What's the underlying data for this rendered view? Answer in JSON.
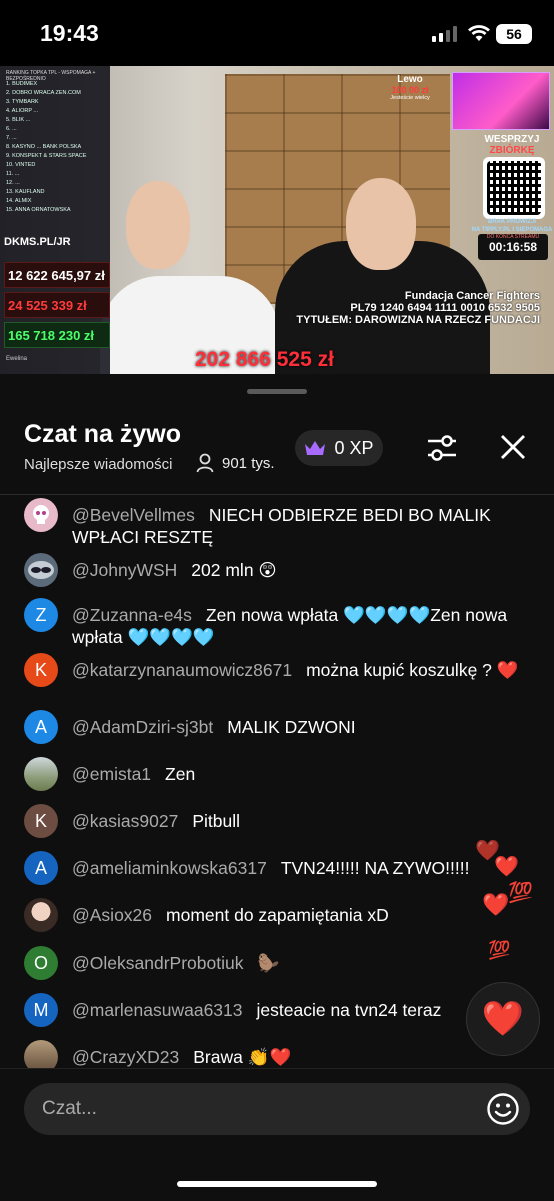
{
  "status_bar": {
    "time": "19:43",
    "battery": "56"
  },
  "stream": {
    "ranking_title": "RANKING   TOPKA TPL - WSPOMAGA + BEZPOŚREDNIO",
    "ranking": [
      "1. BUDIMEX",
      "2. DOBRO WRACA ZEN.COM",
      "3. TYMBARK",
      "4. ALIORP ...",
      "5. BLIK ...",
      "6. ...",
      "7. ...",
      "8. KASYNO ... BANK POLSKA",
      "9. KONSPEKT & STARS SPACE",
      "10. VINTED",
      "11. ...",
      "12. ...",
      "13. KAUFLAND",
      "14. ALMIX",
      "15. ANNA ORNATOWSKA"
    ],
    "dkms": "DKMS.PL/JR",
    "stat1_value": "12 622 645,97 zł",
    "stat2_value": "24 525 339 zł",
    "stat3_value": "165 718 230 zł",
    "small_line": "Ewelina",
    "lewo_title": "Lewo",
    "lewo_value": "100 00 zł",
    "lewo_sub": "Jesteście wielcy",
    "support_line1": "WESPRZYJ",
    "support_line2": "ZBIÓRKĘ",
    "brak_line1": "BRAK PROWIZJI",
    "brak_line2": "NA TIPPLY.PL I SIEPOMAGA",
    "timer_label": "DO KOŃCA STREAMU",
    "timer_value": "00:16:58",
    "fund_line1": "Fundacja Cancer Fighters",
    "fund_line2": "PL79 1240 6494 1111 0010 6532 9505",
    "fund_line3": "TYTUŁEM: DAROWIZNA NA RZECZ FUNDACJI",
    "total": "202 866 525 zł"
  },
  "chat": {
    "title": "Czat na żywo",
    "subtitle": "Najlepsze wiadomości",
    "viewers": "901 tys.",
    "xp": "0 XP",
    "input_placeholder": "Czat...",
    "messages": [
      {
        "author": "@BevelVellmes",
        "text": "NIECH ODBIERZE BEDI BO MALIK WPŁACI RESZTĘ",
        "avatar": "",
        "avatar_color": "#e7b9c9"
      },
      {
        "author": "@JohnyWSH",
        "text": "202 mln 😲",
        "avatar": "",
        "avatar_color": "#5b6b7a"
      },
      {
        "author": "@Zuzanna-e4s",
        "text": "Zen nowa wpłata 🩵🩵🩵🩵Zen nowa wpłata 🩵🩵🩵🩵",
        "avatar": "Z",
        "avatar_color": "#1e88e5"
      },
      {
        "author": "@katarzynanaumowicz8671",
        "text": "można kupić koszulkę ? ❤️",
        "avatar": "K",
        "avatar_color": "#e64a19"
      },
      {
        "author": "@AdamDziri-sj3bt",
        "text": "MALIK DZWONI",
        "avatar": "A",
        "avatar_color": "#1e88e5"
      },
      {
        "author": "@emista1",
        "text": "Zen",
        "avatar": "",
        "avatar_color": "#7d8a6a"
      },
      {
        "author": "@kasias9027",
        "text": "Pitbull",
        "avatar": "K",
        "avatar_color": "#6d4c41"
      },
      {
        "author": "@ameliaminkowska6317",
        "text": "TVN24!!!!! NA ZYWO!!!!!",
        "avatar": "A",
        "avatar_color": "#1565c0"
      },
      {
        "author": "@Asiox26",
        "text": "moment do zapamiętania xD",
        "avatar": "",
        "avatar_color": "#c9a38f"
      },
      {
        "author": "@OleksandrProbotiuk",
        "text": "🦫",
        "avatar": "O",
        "avatar_color": "#2e7d32"
      },
      {
        "author": "@marlenasuwaa6313",
        "text": "jesteacie na tvn24 teraz",
        "avatar": "M",
        "avatar_color": "#1565c0"
      },
      {
        "author": "@CrazyXD23",
        "text": "Brawa 👏❤️",
        "avatar": "",
        "avatar_color": "#8a7560"
      }
    ]
  },
  "reactions": {
    "heart_button": "❤️",
    "float_1": "❤️",
    "float_2": "💯",
    "float_3": "💯"
  }
}
